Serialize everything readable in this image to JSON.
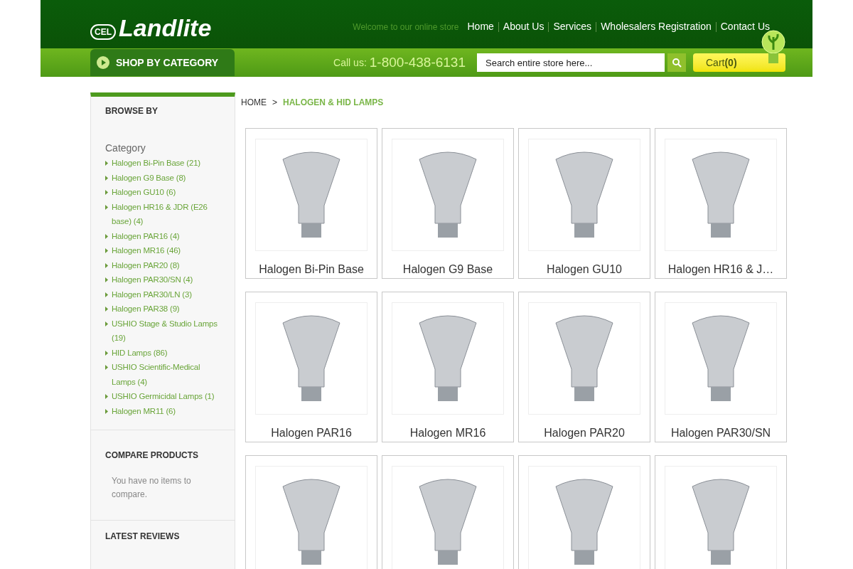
{
  "header": {
    "logo_badge": "CEL",
    "logo_text": "Landlite",
    "welcome": "Welcome to our online store",
    "nav": [
      "Home",
      "About Us",
      "Services",
      "Wholesalers Registration",
      "Contact Us"
    ],
    "shop_by_category": "SHOP BY CATEGORY",
    "call_label": "Call us:",
    "phone": "1-800-438-6131",
    "search": {
      "placeholder": "Search entire store here..."
    },
    "cart_label": "Cart",
    "cart_count": "(0)"
  },
  "sidebar": {
    "browse_title": "BROWSE BY",
    "category_heading": "Category",
    "categories": [
      "Halogen Bi-Pin Base (21)",
      "Halogen G9 Base (8)",
      "Halogen GU10 (6)",
      "Halogen HR16 & JDR (E26 base) (4)",
      "Halogen PAR16 (4)",
      "Halogen MR16 (46)",
      "Halogen PAR20 (8)",
      "Halogen PAR30/SN (4)",
      "Halogen PAR30/LN (3)",
      "Halogen PAR38 (9)",
      "USHIO Stage & Studio Lamps (19)",
      "HID Lamps (86)",
      "USHIO Scientific-Medical Lamps (4)",
      "USHIO Germicidal Lamps (1)",
      "Halogen MR11 (6)"
    ],
    "compare_title": "COMPARE PRODUCTS",
    "compare_text": "You have no items to compare.",
    "reviews_title": "LATEST REVIEWS"
  },
  "breadcrumb": [
    "HOME",
    ">",
    "HALOGEN & HID LAMPS"
  ],
  "products": [
    {
      "kind": "named",
      "name": "Halogen Bi-Pin Base"
    },
    {
      "kind": "named",
      "name": "Halogen G9 Base"
    },
    {
      "kind": "named",
      "name": "Halogen GU10"
    },
    {
      "kind": "named",
      "name": "Halogen HR16 & J…"
    },
    {
      "kind": "named",
      "name": "Halogen PAR16"
    },
    {
      "kind": "named",
      "name": "Halogen MR16"
    },
    {
      "kind": "named",
      "name": "Halogen PAR20"
    },
    {
      "kind": "named",
      "name": "Halogen PAR30/SN"
    },
    {
      "kind": "image_only"
    },
    {
      "kind": "image_only"
    },
    {
      "kind": "image_only"
    },
    {
      "kind": "image_only"
    }
  ]
}
